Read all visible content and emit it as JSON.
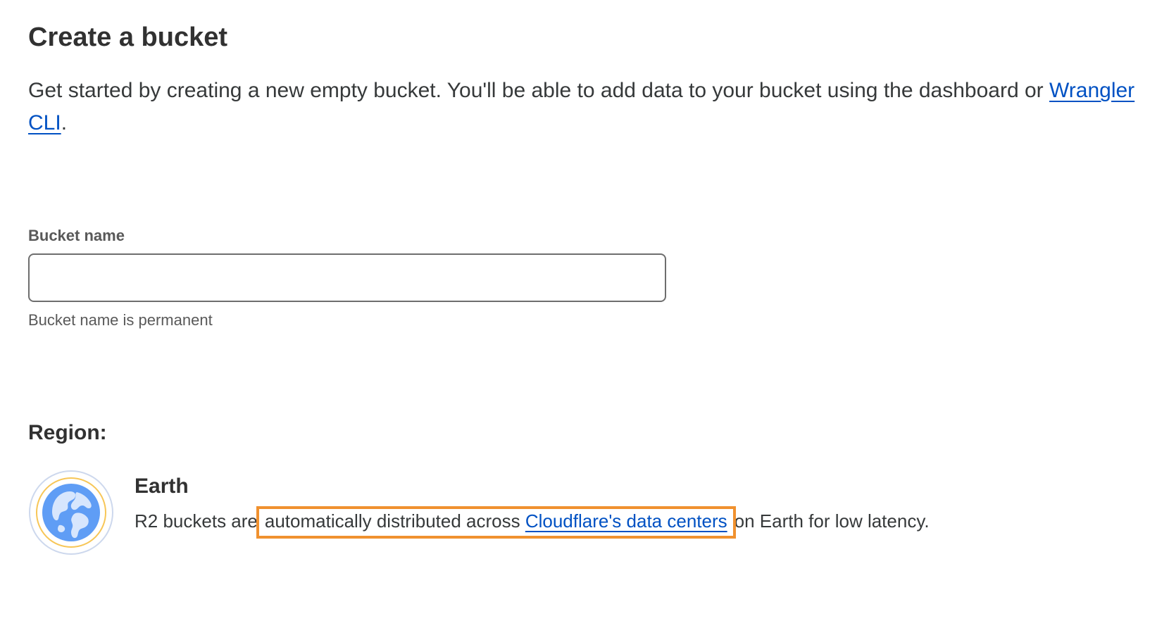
{
  "page": {
    "title": "Create a bucket",
    "intro_text": "Get started by creating a new empty bucket. You'll be able to add data to your bucket using the dashboard or",
    "intro_link": "Wrangler CLI",
    "intro_end": "."
  },
  "bucket_form": {
    "name_label": "Bucket name",
    "name_value": "",
    "name_help": "Bucket name is permanent"
  },
  "region": {
    "heading": "Region:",
    "icon": "globe-icon",
    "name": "Earth",
    "desc_before": "R2 buckets are",
    "desc_highlight_text": "automatically distributed across",
    "desc_link": "Cloudflare's data centers",
    "desc_after": "on Earth for low latency."
  },
  "colors": {
    "link": "#0051c3",
    "highlight_border": "#f0912f",
    "globe_blue": "#5f9df5",
    "globe_ring": "#f7c657"
  }
}
